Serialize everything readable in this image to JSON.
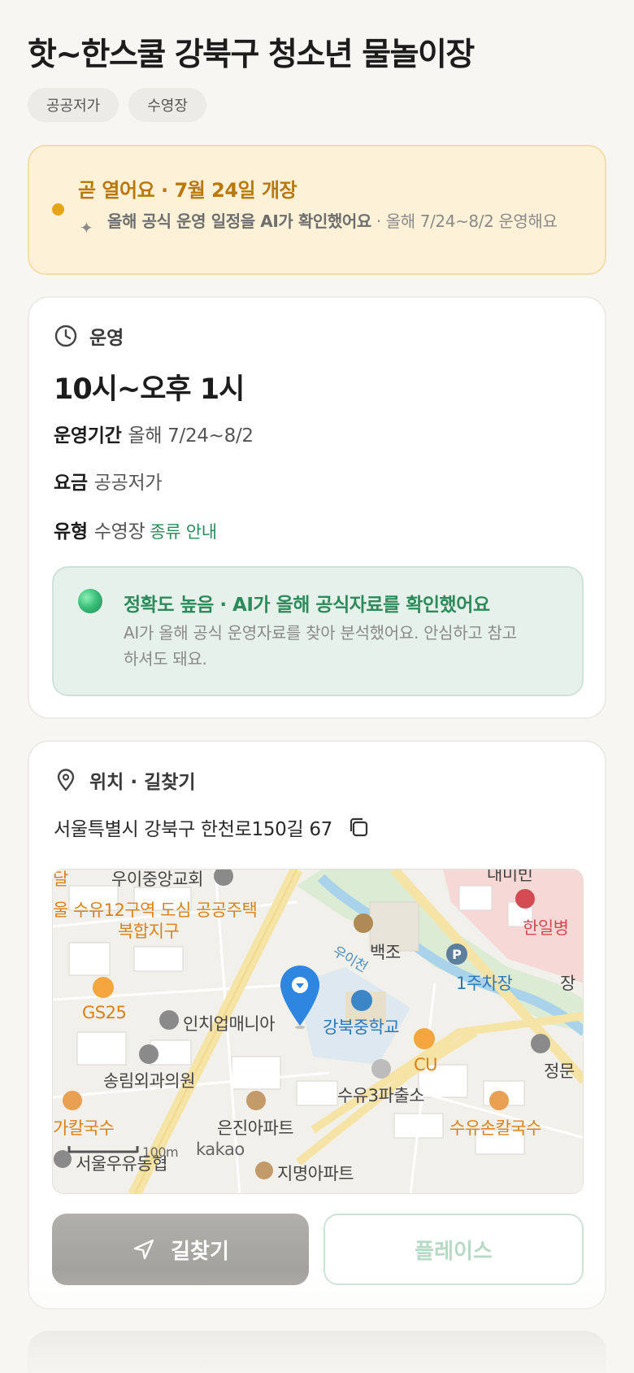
{
  "page": {
    "title": "핫~한스쿨 강북구 청소년 물놀이장",
    "chips": [
      "공공저가",
      "수영장"
    ]
  },
  "notice": {
    "headline": "곧 열어요 · 7월 24일 개장",
    "ai_note_bold": "올해 공식 운영 일정을 AI가 확인했어요",
    "ai_note_rest": " · 올해 7/24~8/2 운영해요"
  },
  "operation": {
    "section_label": "운영",
    "hours": "10시~오후 1시",
    "period_key": "운영기간",
    "period_value": "올해 7/24~8/2",
    "fee_key": "요금",
    "fee_value": "공공저가",
    "type_key": "유형",
    "type_value": "수영장",
    "type_link": "종류 안내",
    "accuracy_title": "정확도 높음 · AI가 올해 공식자료를 확인했어요",
    "accuracy_desc": "AI가 올해 공식 운영자료를 찾아 분석했어요. 안심하고 참고하셔도 돼요."
  },
  "location": {
    "section_label": "위치 · 길찾기",
    "address": "서울특별시 강북구 한천로150길 67",
    "map_labels": {
      "church": "우이중앙교회",
      "cut_top": "대미빈",
      "housing": "울 수유12구역 도심 공공주택",
      "housing2": "복합지구",
      "hospital": "한일병",
      "baekjo": "백조",
      "stream": "우이천",
      "parking": "1주차장",
      "jang": "장",
      "gs25": "GS25",
      "inch": "인치업매니아",
      "school": "강북중학교",
      "cu": "CU",
      "jeongmun": "정문",
      "clinic": "송림외과의원",
      "police": "수유3파출소",
      "kalguksu_left": "가칼국수",
      "apt": "은진아파트",
      "kalguksu_right": "수유손칼국수",
      "scale": "100m",
      "kakao": "kakao",
      "post": "서울우유동협",
      "apt2": "지명아파트",
      "cut_left": "달"
    },
    "btn_route": "길찾기",
    "btn_place": "플레이스"
  },
  "colors": {
    "accent_orange": "#b9780c",
    "accent_green": "#2d8a5a",
    "marker_blue": "#2f86e0"
  }
}
